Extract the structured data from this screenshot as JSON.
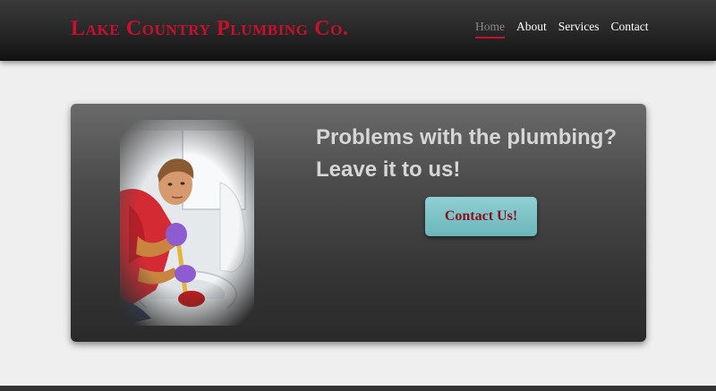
{
  "header": {
    "logo": "Lake Country Plumbing Co.",
    "nav": [
      {
        "label": "Home",
        "active": true
      },
      {
        "label": "About",
        "active": false
      },
      {
        "label": "Services",
        "active": false
      },
      {
        "label": "Contact",
        "active": false
      }
    ]
  },
  "hero": {
    "headline_line1": "Problems with the plumbing?",
    "headline_line2": "Leave it to us!",
    "cta_label": "Contact Us!",
    "image_subject": "plumber-with-plunger-photo"
  },
  "colors": {
    "brand_red": "#c8102e",
    "cta_teal": "#7cc4c8",
    "header_dark": "#262626",
    "page_bg": "#efefef"
  }
}
